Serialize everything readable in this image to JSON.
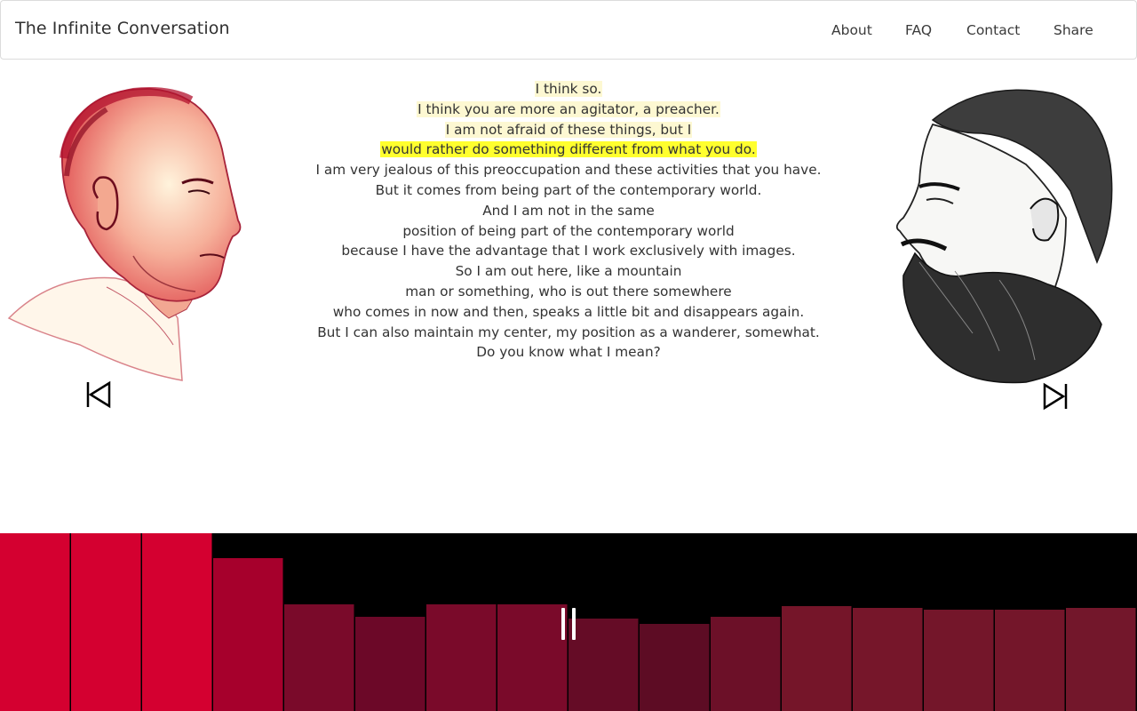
{
  "header": {
    "title": "The Infinite Conversation",
    "nav": [
      "About",
      "FAQ",
      "Contact",
      "Share"
    ]
  },
  "transcript": {
    "lines": [
      {
        "text": "I think so.",
        "highlight": "soft"
      },
      {
        "text": "I think you are more an agitator, a preacher.",
        "highlight": "soft"
      },
      {
        "text": "I am not afraid of these things, but I",
        "highlight": "soft"
      },
      {
        "text": "would rather do something different from what you do.",
        "highlight": "strong"
      },
      {
        "text": "I am very jealous of this preoccupation and these activities that you have.",
        "highlight": "none"
      },
      {
        "text": "But it comes from being part of the contemporary world.",
        "highlight": "none"
      },
      {
        "text": "And I am not in the same",
        "highlight": "none"
      },
      {
        "text": "position of being part of the contemporary world",
        "highlight": "none"
      },
      {
        "text": "because I have the advantage that I work exclusively with images.",
        "highlight": "none"
      },
      {
        "text": "So I am out here, like a mountain",
        "highlight": "none"
      },
      {
        "text": "man or something, who is out there somewhere",
        "highlight": "none"
      },
      {
        "text": "who comes in now and then, speaks a little bit and disappears again.",
        "highlight": "none"
      },
      {
        "text": "But I can also maintain my center, my position as a wanderer, somewhat.",
        "highlight": "none"
      },
      {
        "text": "Do you know what I mean?",
        "highlight": "none"
      }
    ]
  },
  "controls": {
    "skip_back_icon": "skip-back-icon",
    "skip_forward_icon": "skip-forward-icon",
    "pause_icon": "pause-icon"
  },
  "visualizer": {
    "levels": [
      1.0,
      1.0,
      1.0,
      0.86,
      0.6,
      0.53,
      0.6,
      0.6,
      0.52,
      0.49,
      0.53,
      0.59,
      0.58,
      0.57,
      0.57,
      0.58
    ],
    "colors": [
      "#d40030",
      "#d40030",
      "#d40030",
      "#a6002c",
      "#7a0a2a",
      "#6c0828",
      "#7a0a2a",
      "#7a0a2a",
      "#650c26",
      "#5d0c24",
      "#6c1028",
      "#751529",
      "#76162a",
      "#74162a",
      "#74162a",
      "#73172b"
    ]
  },
  "colors": {
    "highlight_soft": "#fdf8d2",
    "highlight_strong": "#ffff2e",
    "visualizer_bg": "#000000"
  }
}
